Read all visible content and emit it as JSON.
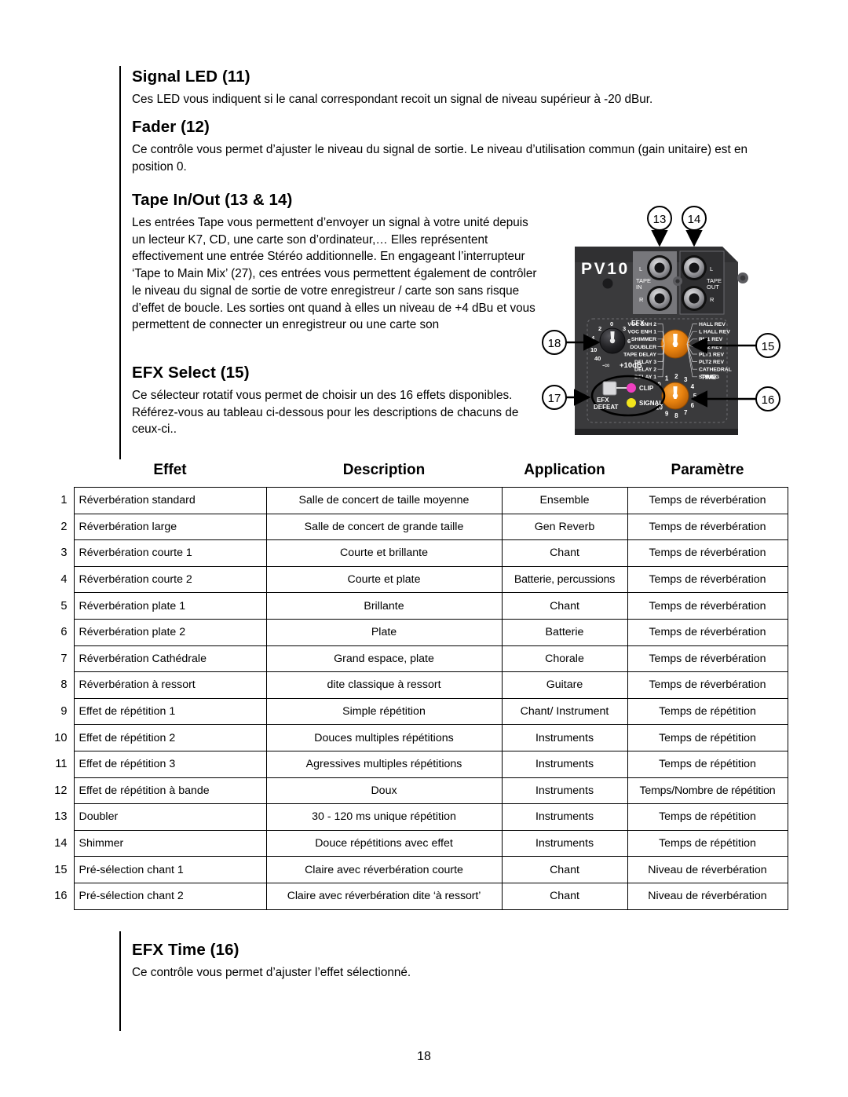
{
  "page": {
    "number": "18"
  },
  "sections": [
    {
      "id": "signal-led",
      "heading": "Signal LED (11)",
      "body": "Ces LED vous indiquent si le canal correspondant recoit un signal  de niveau supérieur à -20 dBur."
    },
    {
      "id": "fader",
      "heading": "Fader (12)",
      "body": "Ce contrôle vous permet d’ajuster le niveau du signal de sortie. Le niveau d’utilisation commun (gain unitaire) est en position 0."
    },
    {
      "id": "tape-in-out",
      "heading": "Tape In/Out (13 & 14)",
      "body": "Les entrées Tape vous permettent d’envoyer un signal à votre unité depuis un lecteur K7, CD, une carte son d’ordinateur,… Elles représentent effectivement une entrée Stéréo additionnelle. En engageant l’interrupteur ‘Tape to Main Mix’ (27), ces entrées vous permettent également de contrôler le niveau du signal de sortie de votre enregistreur / carte son sans risque d’effet de boucle. Les sorties ont quand à elles un niveau de +4 dBu et vous permettent de connecter un enregistreur ou une carte son"
    },
    {
      "id": "efx-select",
      "heading": "EFX Select (15)",
      "body": "Ce sélecteur rotatif vous permet de choisir un des 16 effets disponibles. Référez-vous au tableau ci-dessous pour les descriptions de chacuns de ceux-ci.."
    },
    {
      "id": "efx-time",
      "heading": "EFX Time (16)",
      "body": "Ce contrôle vous permet d’ajuster l’effet sélectionné."
    }
  ],
  "table": {
    "headers": {
      "num": "",
      "effet": "Effet",
      "description": "Description",
      "application": "Application",
      "parametre": "Paramètre"
    },
    "rows": [
      {
        "num": "1",
        "effet": "Réverbération standard",
        "description": "Salle de concert de taille moyenne",
        "application": "Ensemble",
        "parametre": "Temps de réverbération"
      },
      {
        "num": "2",
        "effet": "Réverbération large",
        "description": "Salle de concert de grande taille",
        "application": "Gen Reverb",
        "parametre": "Temps de réverbération"
      },
      {
        "num": "3",
        "effet": "Réverbération courte 1",
        "description": "Courte et brillante",
        "application": "Chant",
        "parametre": "Temps de réverbération"
      },
      {
        "num": "4",
        "effet": "Réverbération courte 2",
        "description": "Courte et plate",
        "application": "Batterie, percussions",
        "parametre": "Temps de réverbération"
      },
      {
        "num": "5",
        "effet": "Réverbération plate 1",
        "description": "Brillante",
        "application": "Chant",
        "parametre": "Temps de réverbération"
      },
      {
        "num": "6",
        "effet": "Réverbération plate 2",
        "description": "Plate",
        "application": "Batterie",
        "parametre": "Temps de réverbération"
      },
      {
        "num": "7",
        "effet": "Réverbération Cathédrale",
        "description": "Grand espace, plate",
        "application": "Chorale",
        "parametre": "Temps de réverbération"
      },
      {
        "num": "8",
        "effet": "Réverbération à ressort",
        "description": "dite classique à ressort",
        "application": "Guitare",
        "parametre": "Temps de réverbération"
      },
      {
        "num": "9",
        "effet": "Effet de répétition 1",
        "description": "Simple répétition",
        "application": "Chant/ Instrument",
        "parametre": "Temps de répétition"
      },
      {
        "num": "10",
        "effet": "Effet de répétition 2",
        "description": "Douces multiples répétitions",
        "application": "Instruments",
        "parametre": "Temps de répétition"
      },
      {
        "num": "11",
        "effet": "Effet de répétition 3",
        "description": "Agressives multiples répétitions",
        "application": "Instruments",
        "parametre": "Temps de répétition"
      },
      {
        "num": "12",
        "effet": "Effet de répétition à bande",
        "description": "Doux",
        "application": "Instruments",
        "parametre": "Temps/Nombre de répétition"
      },
      {
        "num": "13",
        "effet": "Doubler",
        "description": "30 - 120 ms unique répétition",
        "application": "Instruments",
        "parametre": "Temps de répétition"
      },
      {
        "num": "14",
        "effet": "Shimmer",
        "description": "Douce répétitions avec effet",
        "application": "Instruments",
        "parametre": "Temps de répétition"
      },
      {
        "num": "15",
        "effet": "Pré-sélection chant 1",
        "description": "Claire avec réverbération courte",
        "application": "Chant",
        "parametre": "Niveau de réverbération"
      },
      {
        "num": "16",
        "effet": "Pré-sélection chant 2",
        "description": "Claire avec réverbération dite ‘à ressort’",
        "application": "Chant",
        "parametre": "Niveau de réverbération"
      }
    ]
  },
  "device": {
    "brand": "PV10",
    "colors": {
      "panel": "#3a3a3c",
      "panel_dark": "#2b2b2d",
      "jack_plate": "#6f6f72",
      "knob_orange": "#e8820f",
      "knob_dark": "#1c1c1e",
      "led_clip": "#ef3fc0",
      "led_signal": "#f2e51c",
      "label": "#ffffff"
    },
    "jacks": {
      "tape_in_label": "TAPE\nIN",
      "tape_in_label_line1": "TAPE",
      "tape_in_label_line2": "IN",
      "tape_out_label_line1": "TAPE",
      "tape_out_label_line2": "OUT",
      "left_label": "L",
      "right_label": "R"
    },
    "efx_level_knob": {
      "label": "EFX",
      "ticks": [
        "0",
        "2",
        "3",
        "4",
        "6",
        "10",
        "40"
      ],
      "min_label": "-∞",
      "max_label": "+10dB"
    },
    "efx_select_knob": {
      "left_labels": [
        "VOC ENH 2",
        "VOC ENH 1",
        "SHIMMER",
        "DOUBLER",
        "TAPE DELAY",
        "DELAY 3",
        "DELAY 2",
        "DELAY 1"
      ],
      "right_labels": [
        "HALL REV",
        "L HALL REV",
        "RM1 REV",
        "RM2 REV",
        "PLT1 REV",
        "PLT2 REV",
        "CATHEDRAL",
        "SPRING"
      ]
    },
    "time_knob": {
      "label": "TIME",
      "ticks": [
        "0",
        "1",
        "2",
        "3",
        "4",
        "5",
        "6",
        "7",
        "8",
        "9",
        "10"
      ]
    },
    "defeat": {
      "label_line1": "EFX",
      "label_line2": "DEFEAT",
      "clip_label": "CLIP",
      "signal_label": "SIGNAL"
    },
    "callouts": [
      {
        "id": "callout-13",
        "label": "13"
      },
      {
        "id": "callout-14",
        "label": "14"
      },
      {
        "id": "callout-15",
        "label": "15"
      },
      {
        "id": "callout-16",
        "label": "16"
      },
      {
        "id": "callout-17",
        "label": "17"
      },
      {
        "id": "callout-18",
        "label": "18"
      }
    ]
  }
}
